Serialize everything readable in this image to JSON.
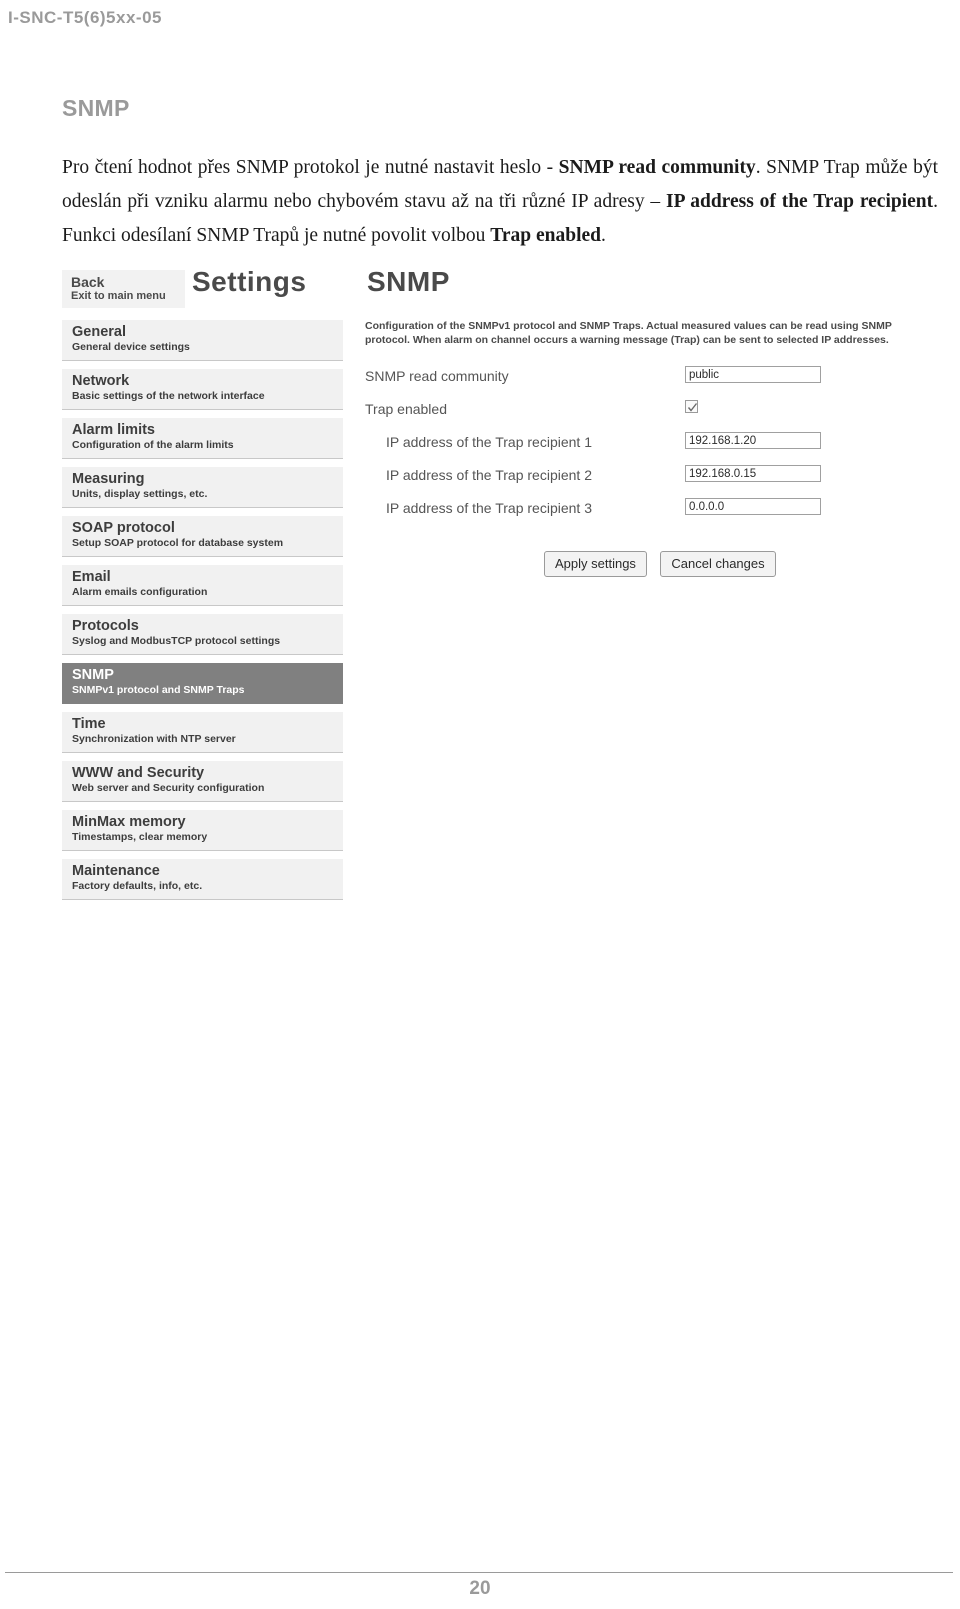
{
  "document": {
    "header": "I-SNC-T5(6)5xx-05",
    "page_number": "20",
    "section_title": "SNMP"
  },
  "paragraph": {
    "seg1": "Pro čtení hodnot přes SNMP protokol je nutné nastavit heslo - ",
    "bold1": "SNMP read community",
    "seg2": ". SNMP Trap může být odeslán při vzniku alarmu nebo chybovém stavu až na tři různé IP adresy – ",
    "bold2": "IP address of the Trap recipient",
    "seg3": ". Funkci odesílaní SNMP Trapů je nutné povolit volbou ",
    "bold3": "Trap enabled",
    "seg4": "."
  },
  "app": {
    "back_button": {
      "title": "Back",
      "subtitle": "Exit to main menu"
    },
    "heading_settings": "Settings",
    "heading_page": "SNMP",
    "sidebar": [
      {
        "title": "General",
        "subtitle": "General device settings",
        "active": false
      },
      {
        "title": "Network",
        "subtitle": "Basic settings of the network interface",
        "active": false
      },
      {
        "title": "Alarm limits",
        "subtitle": "Configuration of the alarm limits",
        "active": false
      },
      {
        "title": "Measuring",
        "subtitle": "Units, display settings, etc.",
        "active": false
      },
      {
        "title": "SOAP protocol",
        "subtitle": "Setup SOAP protocol for database system",
        "active": false
      },
      {
        "title": "Email",
        "subtitle": "Alarm emails configuration",
        "active": false
      },
      {
        "title": "Protocols",
        "subtitle": "Syslog and ModbusTCP protocol settings",
        "active": false
      },
      {
        "title": "SNMP",
        "subtitle": "SNMPv1 protocol and SNMP Traps",
        "active": true
      },
      {
        "title": "Time",
        "subtitle": "Synchronization with NTP server",
        "active": false
      },
      {
        "title": "WWW and Security",
        "subtitle": "Web server and Security configuration",
        "active": false
      },
      {
        "title": "MinMax memory",
        "subtitle": "Timestamps, clear memory",
        "active": false
      },
      {
        "title": "Maintenance",
        "subtitle": "Factory defaults, info, etc.",
        "active": false
      }
    ],
    "panel": {
      "description": "Configuration of the SNMPv1 protocol and SNMP Traps. Actual measured values can be read using SNMP protocol. When alarm on channel occurs a warning message (Trap) can be sent to selected IP addresses.",
      "fields": {
        "read_community_label": "SNMP read community",
        "read_community_value": "public",
        "trap_enabled_label": "Trap enabled",
        "trap_enabled_checked": true,
        "trap_ip_1_label": "IP address of the Trap recipient 1",
        "trap_ip_1_value": "192.168.1.20",
        "trap_ip_2_label": "IP address of the Trap recipient 2",
        "trap_ip_2_value": "192.168.0.15",
        "trap_ip_3_label": "IP address of the Trap recipient 3",
        "trap_ip_3_value": "0.0.0.0"
      },
      "buttons": {
        "apply": "Apply settings",
        "cancel": "Cancel changes"
      }
    }
  },
  "colors": {
    "header_gray": "#9a9a9a",
    "active_item": "#808080",
    "item_bg": "#f1f1f1"
  }
}
